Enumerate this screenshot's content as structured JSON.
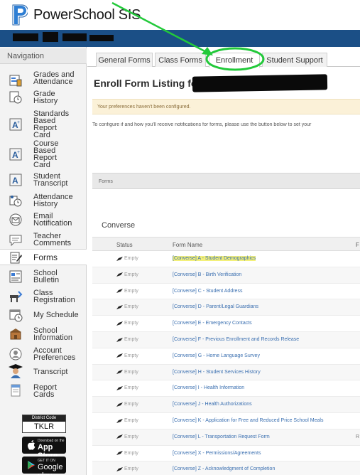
{
  "brand": {
    "name": "PowerSchool SIS",
    "accent": "#1b4f86"
  },
  "navigation": {
    "title": "Navigation",
    "items": [
      {
        "label1": "Grades and",
        "label2": "Attendance",
        "label3": "",
        "label4": "",
        "icon": "grades-icon"
      },
      {
        "label1": "Grade",
        "label2": "History",
        "label3": "",
        "label4": "",
        "icon": "history-icon"
      },
      {
        "label1": "Standards",
        "label2": "Based",
        "label3": "Report",
        "label4": "Card",
        "icon": "report-card-icon"
      },
      {
        "label1": "Course",
        "label2": "Based",
        "label3": "Report",
        "label4": "Card",
        "icon": "report-card-icon"
      },
      {
        "label1": "Student",
        "label2": "Transcript",
        "label3": "",
        "label4": "",
        "icon": "transcript-icon"
      },
      {
        "label1": "Attendance",
        "label2": "History",
        "label3": "",
        "label4": "",
        "icon": "attendance-icon"
      },
      {
        "label1": "Email",
        "label2": "Notification",
        "label3": "",
        "label4": "",
        "icon": "email-icon"
      },
      {
        "label1": "Teacher",
        "label2": "Comments",
        "label3": "",
        "label4": "",
        "icon": "comment-icon"
      },
      {
        "label1": "Forms",
        "label2": "",
        "label3": "",
        "label4": "",
        "icon": "forms-icon"
      },
      {
        "label1": "School",
        "label2": "Bulletin",
        "label3": "",
        "label4": "",
        "icon": "bulletin-icon"
      },
      {
        "label1": "Class",
        "label2": "Registration",
        "label3": "",
        "label4": "",
        "icon": "registration-icon"
      },
      {
        "label1": "My Schedule",
        "label2": "",
        "label3": "",
        "label4": "",
        "icon": "calendar-icon"
      },
      {
        "label1": "School",
        "label2": "Information",
        "label3": "",
        "label4": "",
        "icon": "school-icon"
      },
      {
        "label1": "Account",
        "label2": "Preferences",
        "label3": "",
        "label4": "",
        "icon": "account-icon"
      },
      {
        "label1": "Transcript",
        "label2": "",
        "label3": "",
        "label4": "",
        "icon": "graduate-icon"
      },
      {
        "label1": "Report",
        "label2": "Cards",
        "label3": "",
        "label4": "",
        "icon": "report-icon"
      }
    ],
    "district_code_label": "District Code",
    "district_code": "TKLR",
    "app_store_small": "Download on the",
    "app_store_big": "App Store",
    "google_play_small": "GET IT ON",
    "google_play_big": "Google play"
  },
  "tabs": [
    {
      "label": "General Forms"
    },
    {
      "label": "Class Forms"
    },
    {
      "label": "Enrollment"
    },
    {
      "label": "Student Support"
    }
  ],
  "page_title": "Enroll Form Listing for",
  "notice": "Your preferences haven't been configured.",
  "config_text": "To configure if and how you'll receive notifications for forms, please use the button below to set your",
  "forms_header": "Forms",
  "section_title": "Converse",
  "table": {
    "headers": {
      "status": "Status",
      "form_name": "Form Name",
      "extra": "F"
    },
    "rows": [
      {
        "status": "Empty",
        "name": "[Converse] A - Student Demographics",
        "extra": ""
      },
      {
        "status": "Empty",
        "name": "[Converse] B - Birth Verification",
        "extra": ""
      },
      {
        "status": "Empty",
        "name": "[Converse] C - Student Address",
        "extra": ""
      },
      {
        "status": "Empty",
        "name": "[Converse] D - Parent/Legal Guardians",
        "extra": ""
      },
      {
        "status": "Empty",
        "name": "[Converse] E - Emergency Contacts",
        "extra": ""
      },
      {
        "status": "Empty",
        "name": "[Converse] F - Previous Enrollment and Records Release",
        "extra": ""
      },
      {
        "status": "Empty",
        "name": "[Converse] G - Home Language Survey",
        "extra": ""
      },
      {
        "status": "Empty",
        "name": "[Converse] H - Student Services History",
        "extra": ""
      },
      {
        "status": "Empty",
        "name": "[Converse] I - Health Information",
        "extra": ""
      },
      {
        "status": "Empty",
        "name": "[Converse] J - Health Authorizations",
        "extra": ""
      },
      {
        "status": "Empty",
        "name": "[Converse] K - Application for Free and Reduced Price School Meals",
        "extra": ""
      },
      {
        "status": "Empty",
        "name": "[Converse] L - Transportation Request Form",
        "extra": "R"
      },
      {
        "status": "Empty",
        "name": "[Converse] X - Permissions/Agreements",
        "extra": ""
      },
      {
        "status": "Empty",
        "name": "[Converse] Z - Acknowledgment of Completion",
        "extra": ""
      }
    ]
  },
  "annotation_color": "#22c93a"
}
